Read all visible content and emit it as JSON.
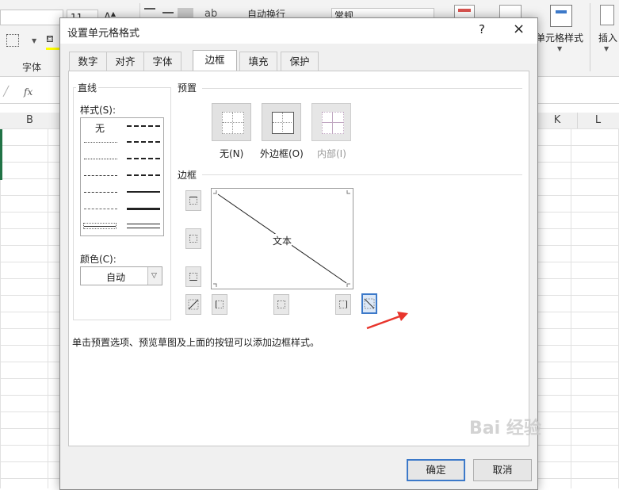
{
  "excel": {
    "font_size_value": "11",
    "ribbon_partial_text_1": "自动换行",
    "number_format_value": "常规",
    "font_group_label": "字体",
    "cell_styles_label": "单元格样式",
    "insert_label": "插入",
    "fx_label": "fx",
    "columns": [
      "B",
      "K",
      "L"
    ]
  },
  "dialog": {
    "title": "设置单元格格式",
    "help": "?",
    "close": "×",
    "tabs": [
      "数字",
      "对齐",
      "字体",
      "边框",
      "填充",
      "保护"
    ],
    "active_tab": "边框",
    "line_section": {
      "title": "直线",
      "style_label": "样式(S):",
      "none_label": "无",
      "color_label": "颜色(C):",
      "color_value": "自动"
    },
    "presets_section": {
      "title": "预置",
      "items": [
        {
          "label": "无(N)",
          "enabled": true
        },
        {
          "label": "外边框(O)",
          "enabled": true
        },
        {
          "label": "内部(I)",
          "enabled": false
        }
      ]
    },
    "border_section": {
      "title": "边框",
      "preview_text": "文本",
      "diagonal_down_selected": true
    },
    "hint": "单击预置选项、预览草图及上面的按钮可以添加边框样式。",
    "ok_label": "确定",
    "cancel_label": "取消"
  },
  "annotation": {
    "arrow_color": "#e8352c"
  },
  "watermark_text": "Bai 经验"
}
